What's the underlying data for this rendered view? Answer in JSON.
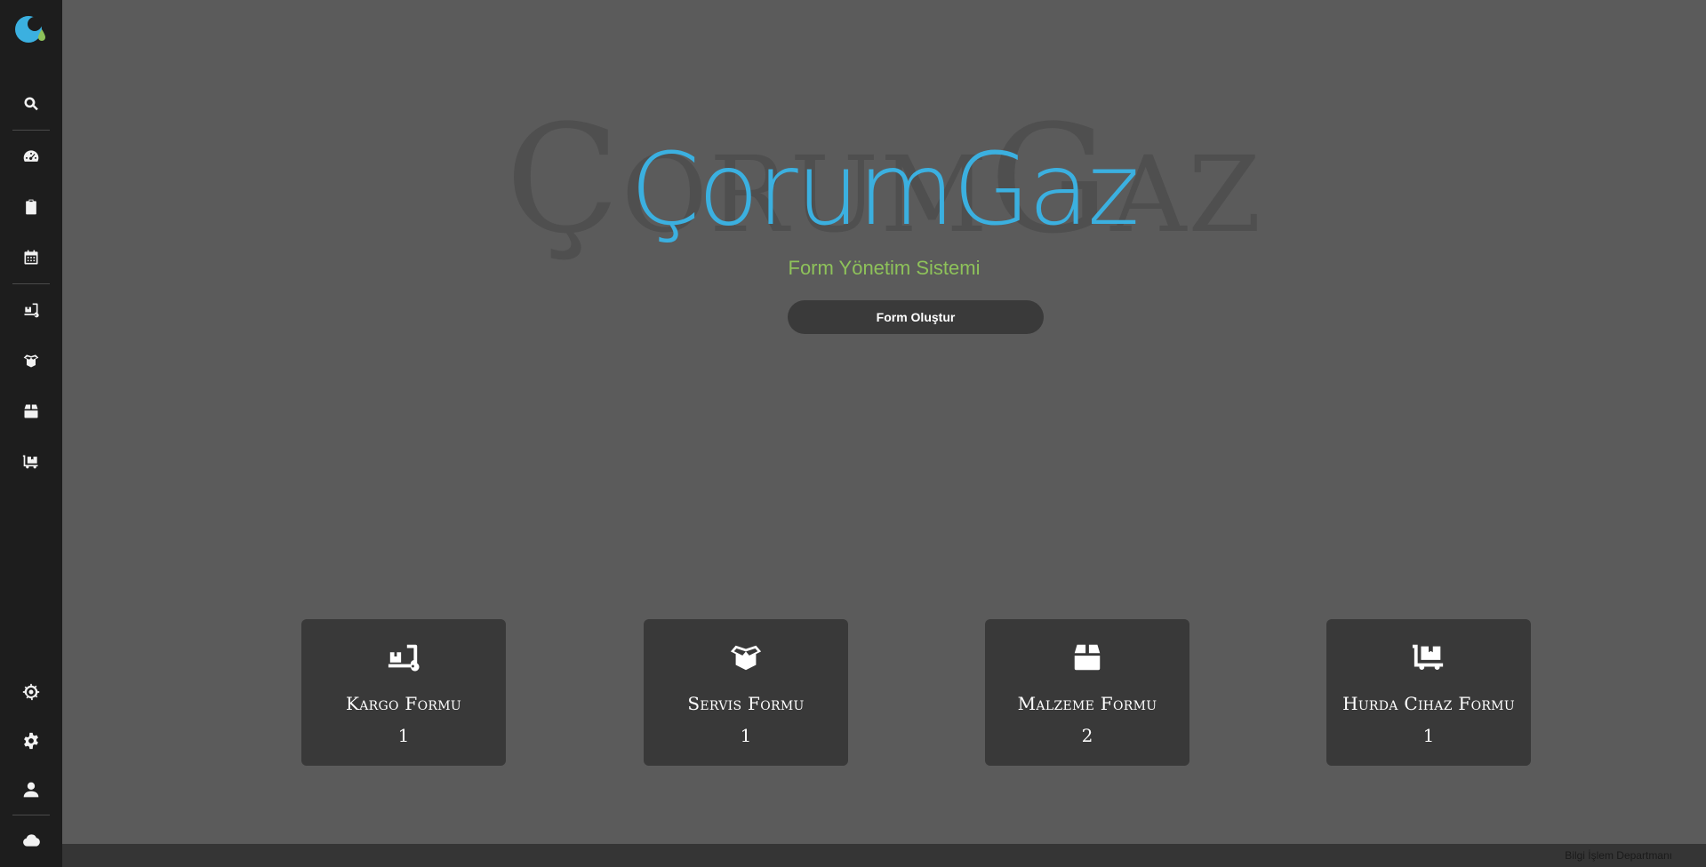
{
  "brand": {
    "title": "ÇorumGaz",
    "subtitle": "Form Yönetim Sistemi",
    "background_word": "ÇorumGaz",
    "accent": "#3bb0e0",
    "secondary_accent": "#8ec25a"
  },
  "sidebar": {
    "top_items": [
      {
        "icon": "search-icon"
      },
      {
        "icon": "dashboard-icon"
      },
      {
        "icon": "clipboard-icon"
      },
      {
        "icon": "calendar-icon"
      },
      {
        "icon": "dolly-icon"
      },
      {
        "icon": "box-open-icon"
      },
      {
        "icon": "box-icon"
      },
      {
        "icon": "cart-flatbed-icon"
      }
    ],
    "bottom_items": [
      {
        "icon": "dharmachakra-icon"
      },
      {
        "icon": "gear-icon"
      },
      {
        "icon": "user-icon"
      },
      {
        "icon": "cloud-icon"
      }
    ]
  },
  "actions": {
    "create_form_label": "Form Oluştur"
  },
  "cards": [
    {
      "label": "Kargo Formu",
      "count": "1",
      "icon": "dolly-icon"
    },
    {
      "label": "Servis Formu",
      "count": "1",
      "icon": "box-open-icon"
    },
    {
      "label": "Malzeme Formu",
      "count": "2",
      "icon": "box-icon"
    },
    {
      "label": "Hurda Cihaz Formu",
      "count": "1",
      "icon": "cart-flatbed-icon"
    }
  ],
  "footer": {
    "text": "Bilgi İşlem Departmanı"
  }
}
